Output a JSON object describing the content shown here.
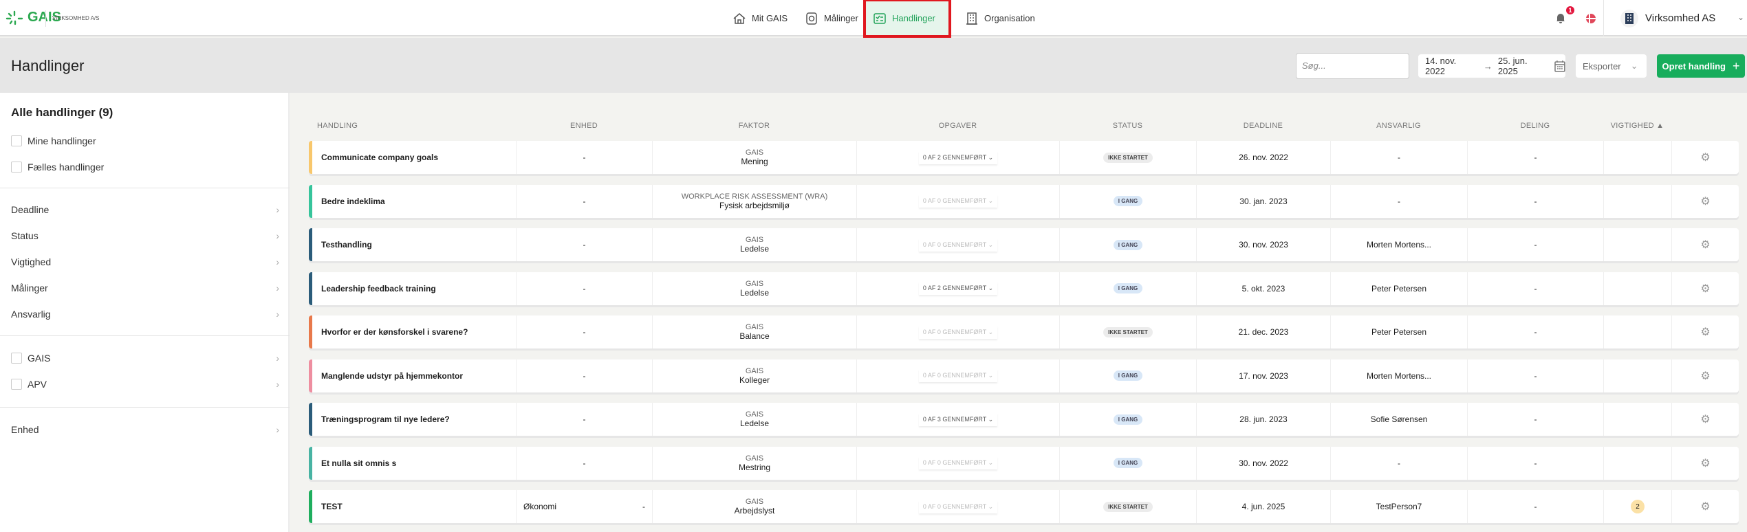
{
  "header": {
    "logo": "GAIS",
    "company_small": "VIRKSOMHED A/S",
    "nav": [
      {
        "label": "Mit GAIS",
        "icon": "home-icon"
      },
      {
        "label": "Målinger",
        "icon": "measurement-icon"
      },
      {
        "label": "Handlinger",
        "icon": "actions-icon",
        "active": true
      },
      {
        "label": "Organisation",
        "icon": "building-icon"
      }
    ],
    "notifications": "1",
    "org_name": "Virksomhed AS"
  },
  "toolbar": {
    "title": "Handlinger",
    "search_placeholder": "Søg...",
    "date_from": "14. nov. 2022",
    "date_arrow": "→",
    "date_to": "25. jun. 2025",
    "export": "Eksporter",
    "create": "Opret handling",
    "create_icon": "+"
  },
  "sidebar": {
    "title": "Alle handlinger (9)",
    "checks": [
      "Mine handlinger",
      "Fælles handlinger"
    ],
    "filters": [
      "Deadline",
      "Status",
      "Vigtighed",
      "Målinger",
      "Ansvarlig"
    ],
    "sources": [
      "GAIS",
      "APV"
    ],
    "unit": "Enhed"
  },
  "table": {
    "columns": [
      "HANDLING",
      "ENHED",
      "FAKTOR",
      "OPGAVER",
      "STATUS",
      "DEADLINE",
      "ANSVARLIG",
      "DELING",
      "VIGTIGHED ▲"
    ],
    "rows": [
      {
        "name": "Communicate company goals",
        "unit": "-",
        "unit_extra": "",
        "factor_top": "GAIS",
        "factor": "Mening",
        "tasks": "0 AF 2 GENNEMFØRT ⌄",
        "tasks_active": true,
        "status": "IKKE STARTET",
        "status_type": "ns",
        "deadline": "26. nov. 2022",
        "owner": "-",
        "share": "-",
        "priority": "",
        "color": "#f8c76c"
      },
      {
        "name": "Bedre indeklima",
        "unit": "-",
        "unit_extra": "",
        "factor_top": "WORKPLACE RISK ASSESSMENT (WRA)",
        "factor": "Fysisk arbejdsmiljø",
        "tasks": "0 AF 0 GENNEMFØRT ⌄",
        "tasks_active": false,
        "status": "I GANG",
        "status_type": "ig",
        "deadline": "30. jan. 2023",
        "owner": "-",
        "share": "-",
        "priority": "",
        "color": "#36c49b"
      },
      {
        "name": "Testhandling",
        "unit": "-",
        "unit_extra": "",
        "factor_top": "GAIS",
        "factor": "Ledelse",
        "tasks": "0 AF 0 GENNEMFØRT ⌄",
        "tasks_active": false,
        "status": "I GANG",
        "status_type": "ig",
        "deadline": "30. nov. 2023",
        "owner": "Morten Mortens...",
        "share": "-",
        "priority": "",
        "color": "#2b5c7a"
      },
      {
        "name": "Leadership feedback training",
        "unit": "-",
        "unit_extra": "",
        "factor_top": "GAIS",
        "factor": "Ledelse",
        "tasks": "0 AF 2 GENNEMFØRT ⌄",
        "tasks_active": true,
        "status": "I GANG",
        "status_type": "ig",
        "deadline": "5. okt. 2023",
        "owner": "Peter Petersen",
        "share": "-",
        "priority": "",
        "color": "#2b5c7a"
      },
      {
        "name": "Hvorfor er der kønsforskel i svarene?",
        "unit": "-",
        "unit_extra": "",
        "factor_top": "GAIS",
        "factor": "Balance",
        "tasks": "0 AF 0 GENNEMFØRT ⌄",
        "tasks_active": false,
        "status": "IKKE STARTET",
        "status_type": "ns",
        "deadline": "21. dec. 2023",
        "owner": "Peter Petersen",
        "share": "-",
        "priority": "",
        "color": "#e8794b"
      },
      {
        "name": "Manglende udstyr på hjemmekontor",
        "unit": "-",
        "unit_extra": "",
        "factor_top": "GAIS",
        "factor": "Kolleger",
        "tasks": "0 AF 0 GENNEMFØRT ⌄",
        "tasks_active": false,
        "status": "I GANG",
        "status_type": "ig",
        "deadline": "17. nov. 2023",
        "owner": "Morten Mortens...",
        "share": "-",
        "priority": "",
        "color": "#ee8ea0"
      },
      {
        "name": "Træningsprogram til nye ledere?",
        "unit": "-",
        "unit_extra": "",
        "factor_top": "GAIS",
        "factor": "Ledelse",
        "tasks": "0 AF 3 GENNEMFØRT ⌄",
        "tasks_active": true,
        "status": "I GANG",
        "status_type": "ig",
        "deadline": "28. jun. 2023",
        "owner": "Sofie Sørensen",
        "share": "-",
        "priority": "",
        "color": "#2b5c7a"
      },
      {
        "name": "Et nulla sit omnis s",
        "unit": "-",
        "unit_extra": "",
        "factor_top": "GAIS",
        "factor": "Mestring",
        "tasks": "0 AF 0 GENNEMFØRT ⌄",
        "tasks_active": false,
        "status": "I GANG",
        "status_type": "ig",
        "deadline": "30. nov. 2022",
        "owner": "-",
        "share": "-",
        "priority": "",
        "color": "#48b3a3"
      },
      {
        "name": "TEST",
        "unit": "Økonomi",
        "unit_extra": "-",
        "factor_top": "GAIS",
        "factor": "Arbejdslyst",
        "tasks": "0 AF 0 GENNEMFØRT ⌄",
        "tasks_active": false,
        "status": "IKKE STARTET",
        "status_type": "ns",
        "deadline": "4. jun. 2025",
        "owner": "TestPerson7",
        "share": "-",
        "priority": "2",
        "color": "#1fae5e"
      }
    ]
  }
}
